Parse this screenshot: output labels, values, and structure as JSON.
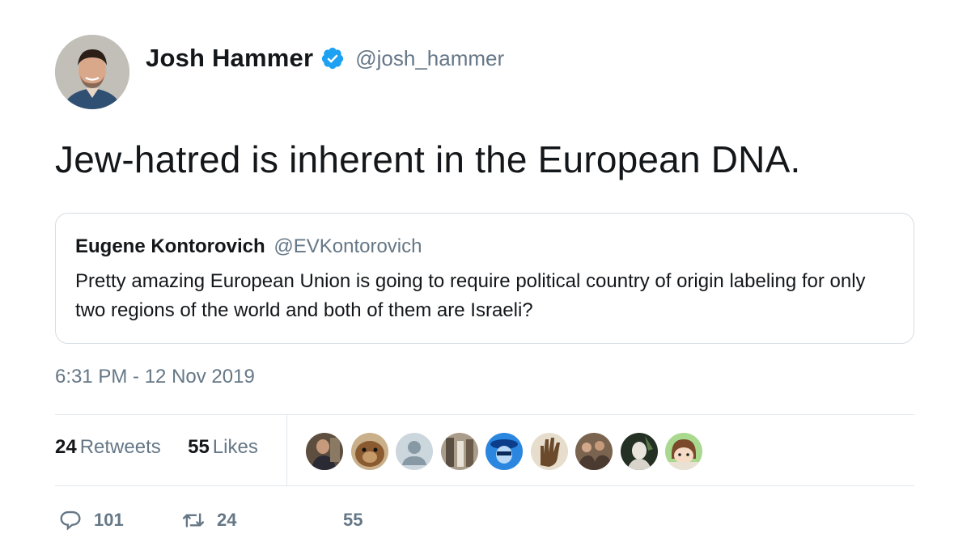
{
  "author": {
    "display_name": "Josh Hammer",
    "handle": "@josh_hammer",
    "verified": true,
    "verified_icon": "verified-badge-icon",
    "avatar_icon": "profile-photo"
  },
  "tweet": {
    "text": "Jew-hatred is inherent in the European DNA.",
    "timestamp": "6:31 PM - 12 Nov 2019"
  },
  "quoted_tweet": {
    "display_name": "Eugene Kontorovich",
    "handle": "@EVKontorovich",
    "text": "Pretty amazing European Union is going to require political  country of origin labeling for only two regions of the world and both of them are Israeli?"
  },
  "stats": {
    "retweets_count": "24",
    "retweets_label": "Retweets",
    "likes_count": "55",
    "likes_label": "Likes"
  },
  "likers": [
    {
      "name": "liker-1",
      "color": "#6b5a4a"
    },
    {
      "name": "liker-2",
      "color": "#a07a50"
    },
    {
      "name": "liker-3",
      "color": "#ccd6dd"
    },
    {
      "name": "liker-4",
      "color": "#8a7e70"
    },
    {
      "name": "liker-5",
      "color": "#1d6fd1"
    },
    {
      "name": "liker-6",
      "color": "#d8cfbf"
    },
    {
      "name": "liker-7",
      "color": "#8a6a50"
    },
    {
      "name": "liker-8",
      "color": "#3a4a3a"
    },
    {
      "name": "liker-9",
      "color": "#8fbf7a"
    }
  ],
  "actions": {
    "reply_count": "101",
    "reply_icon": "reply-icon",
    "retweet_count": "24",
    "retweet_icon": "retweet-icon",
    "like_count": "55",
    "like_icon": "like-icon"
  },
  "colors": {
    "text": "#14171a",
    "secondary": "#657786",
    "verified": "#1da1f2",
    "border": "#e1e8ed"
  }
}
